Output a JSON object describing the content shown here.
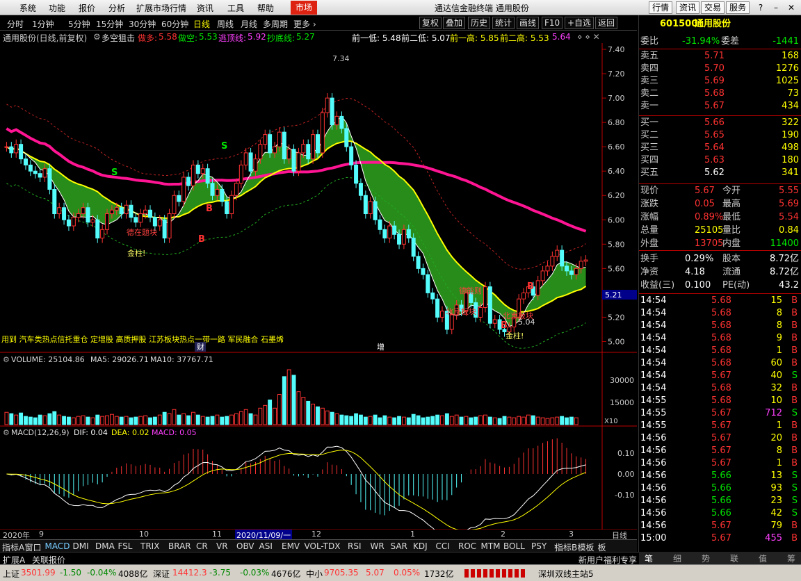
{
  "menu": {
    "items": [
      "系统",
      "功能",
      "报价",
      "分析",
      "扩展市场行情",
      "资讯",
      "工具",
      "帮助"
    ],
    "market": "市场",
    "title": "通达信金融终端  通用股份",
    "right_buttons": [
      "行情",
      "资讯",
      "交易",
      "服务"
    ]
  },
  "toolbar": {
    "periods": [
      "分时",
      "1分钟",
      "5分钟",
      "15分钟",
      "30分钟",
      "60分钟",
      "日线",
      "周线",
      "月线",
      "多周期",
      "更多 ›"
    ],
    "active_period": "日线",
    "tools": [
      "复权",
      "叠加",
      "历史",
      "统计",
      "画线",
      "F10",
      "+自选",
      "返回"
    ]
  },
  "info": {
    "title": "通用股份(日线,前复权)",
    "indicator": "多空狙击",
    "duo_label": "做多:",
    "duo": "5.58",
    "kong_label": "做空:",
    "kong": "5.53",
    "top_label": "逃顶线:",
    "top": "5.92",
    "bottom_label": "抄底线:",
    "bottom": "5.27",
    "p1": "前一低: 5.48",
    "p2": "前二低: 5.07",
    "p3": "前一高: 5.85",
    "p4": "前二高: 5.53",
    "p5": "5.64"
  },
  "axis": {
    "price_ticks": [
      "7.40",
      "7.20",
      "7.00",
      "6.80",
      "6.60",
      "6.40",
      "6.20",
      "6.00",
      "5.80",
      "5.60",
      "5.40",
      "5.20",
      "5.00"
    ],
    "price_tag": "5.21",
    "vol_ticks": [
      "30000",
      "15000"
    ],
    "vol_unit": "X10",
    "macd_ticks": [
      "0.10",
      "0.00",
      "-0.10"
    ],
    "dates": [
      "2020年",
      "9",
      "10",
      "11",
      "2020/11/09/一",
      "12",
      "1",
      "2",
      "3"
    ],
    "date_right": "日线"
  },
  "annotations": {
    "high": "7.34",
    "low": "5.04",
    "s_label": "S",
    "b_label": "B",
    "gold1": "金柱!",
    "gold2": "金柱!",
    "tag1": "德在题块",
    "tag2": "北京板块",
    "tag3": "德能则",
    "tag4": "北京板块",
    "concepts": "用到  汽车类热点信托重仓 定增股 高质押股 江苏板块热点一带一路 军民融合 石墨烯",
    "cai": "财",
    "zeng": "增"
  },
  "volume": {
    "label": "VOLUME: 25104.86",
    "ma5": "MA5: 29026.71",
    "ma10": "MA10: 37767.71"
  },
  "macd": {
    "label": "MACD(12,26,9)",
    "dif": "DIF: 0.04",
    "dea": "DEA: 0.02",
    "macd": "MACD: 0.05"
  },
  "chart_data": {
    "type": "candlestick",
    "title": "通用股份(日线,前复权)",
    "y_range": [
      4.94,
      7.44
    ],
    "closes": [
      6.6,
      6.55,
      6.62,
      6.5,
      6.45,
      6.4,
      6.38,
      6.35,
      6.42,
      6.25,
      6.05,
      6.1,
      6.0,
      5.95,
      6.02,
      6.05,
      6.1,
      5.98,
      6.0,
      5.85,
      5.92,
      6.05,
      6.08,
      6.1,
      6.05,
      6.12,
      6.02,
      5.98,
      6.05,
      6.08,
      6.02,
      5.95,
      6.0,
      5.85,
      6.05,
      6.2,
      6.15,
      6.35,
      6.28,
      6.45,
      6.38,
      6.42,
      6.3,
      6.2,
      6.25,
      6.15,
      6.05,
      6.2,
      6.3,
      6.45,
      6.55,
      6.4,
      6.5,
      6.62,
      6.7,
      6.55,
      6.6,
      6.72,
      6.5,
      6.58,
      6.4,
      6.55,
      6.62,
      6.5,
      6.7,
      6.55,
      6.88,
      7.0,
      6.78,
      6.85,
      6.75,
      6.6,
      6.45,
      6.3,
      6.2,
      6.05,
      6.15,
      6.0,
      5.92,
      5.85,
      5.95,
      5.88,
      5.8,
      5.92,
      5.85,
      5.7,
      5.6,
      5.55,
      5.4,
      5.35,
      5.2,
      5.25,
      5.1,
      5.22,
      5.3,
      5.25,
      5.4,
      5.32,
      5.2,
      5.28,
      5.45,
      5.15,
      5.18,
      5.1,
      5.08,
      5.12,
      5.2,
      5.35,
      5.4,
      5.45,
      5.38,
      5.5,
      5.58,
      5.62,
      5.7,
      5.75,
      5.62,
      5.58,
      5.55,
      5.6,
      5.66,
      5.67
    ],
    "volumes": [
      9000,
      8000,
      7000,
      8500,
      6000,
      5500,
      5000,
      7000,
      6500,
      8000,
      9500,
      7000,
      6000,
      5500,
      5000,
      6000,
      6500,
      5500,
      5000,
      7000,
      6000,
      6500,
      7500,
      6000,
      5500,
      6000,
      5000,
      5500,
      6000,
      6500,
      5000,
      5500,
      7000,
      9000,
      8000,
      11000,
      7000,
      8000,
      6500,
      9000,
      7000,
      6000,
      5500,
      6000,
      7000,
      5500,
      6000,
      7000,
      8000,
      9500,
      11000,
      8000,
      7000,
      12000,
      14000,
      18000,
      12000,
      22000,
      35000,
      40000,
      36000,
      24000,
      20000,
      17000,
      15000,
      13000,
      12000,
      10000,
      9000,
      8000,
      7000,
      6500,
      6000,
      8000,
      7000,
      5500,
      6000,
      7000,
      5000,
      6500,
      5500,
      5000,
      6000,
      5500,
      5000,
      7500,
      6500,
      5000,
      5500,
      6000,
      7000,
      6500,
      8000,
      6000,
      7000,
      5500,
      6000,
      5000,
      5500,
      6500,
      7000,
      5500,
      5000,
      4500,
      6000,
      5500,
      5000,
      6000,
      5500,
      7000,
      6500,
      5500,
      5000,
      4500,
      5000,
      5500,
      6000,
      5000,
      5500,
      5000
    ]
  }
}
